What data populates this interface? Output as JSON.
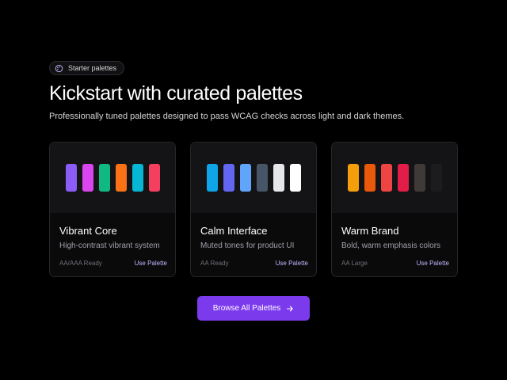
{
  "badge": {
    "label": "Starter palettes",
    "icon": "palette-icon"
  },
  "hero": {
    "title": "Kickstart with curated palettes",
    "subtitle": "Professionally tuned palettes designed to pass WCAG checks across light and dark themes."
  },
  "palettes": [
    {
      "name": "Vibrant Core",
      "description": "High-contrast vibrant system",
      "compliance": "AA/AAA Ready",
      "action": "Use Palette",
      "swatches": [
        "#8b5cf6",
        "#d946ef",
        "#10b981",
        "#f97316",
        "#06b6d4",
        "#f43f5e"
      ]
    },
    {
      "name": "Calm Interface",
      "description": "Muted tones for product UI",
      "compliance": "AA Ready",
      "action": "Use Palette",
      "swatches": [
        "#0ea5e9",
        "#6366f1",
        "#60a5fa",
        "#475569",
        "#e5e7eb",
        "#ffffff"
      ]
    },
    {
      "name": "Warm Brand",
      "description": "Bold, warm emphasis colors",
      "compliance": "AA Large",
      "action": "Use Palette",
      "swatches": [
        "#f59e0b",
        "#ea580c",
        "#ef4444",
        "#e11d48",
        "#3f3a38",
        "#1c1c1e"
      ]
    }
  ],
  "cta": {
    "label": "Browse All Palettes",
    "icon": "arrow-right-icon"
  },
  "colors": {
    "accent": "#7c3aed",
    "link": "#c4b5fd",
    "background": "#000000"
  }
}
